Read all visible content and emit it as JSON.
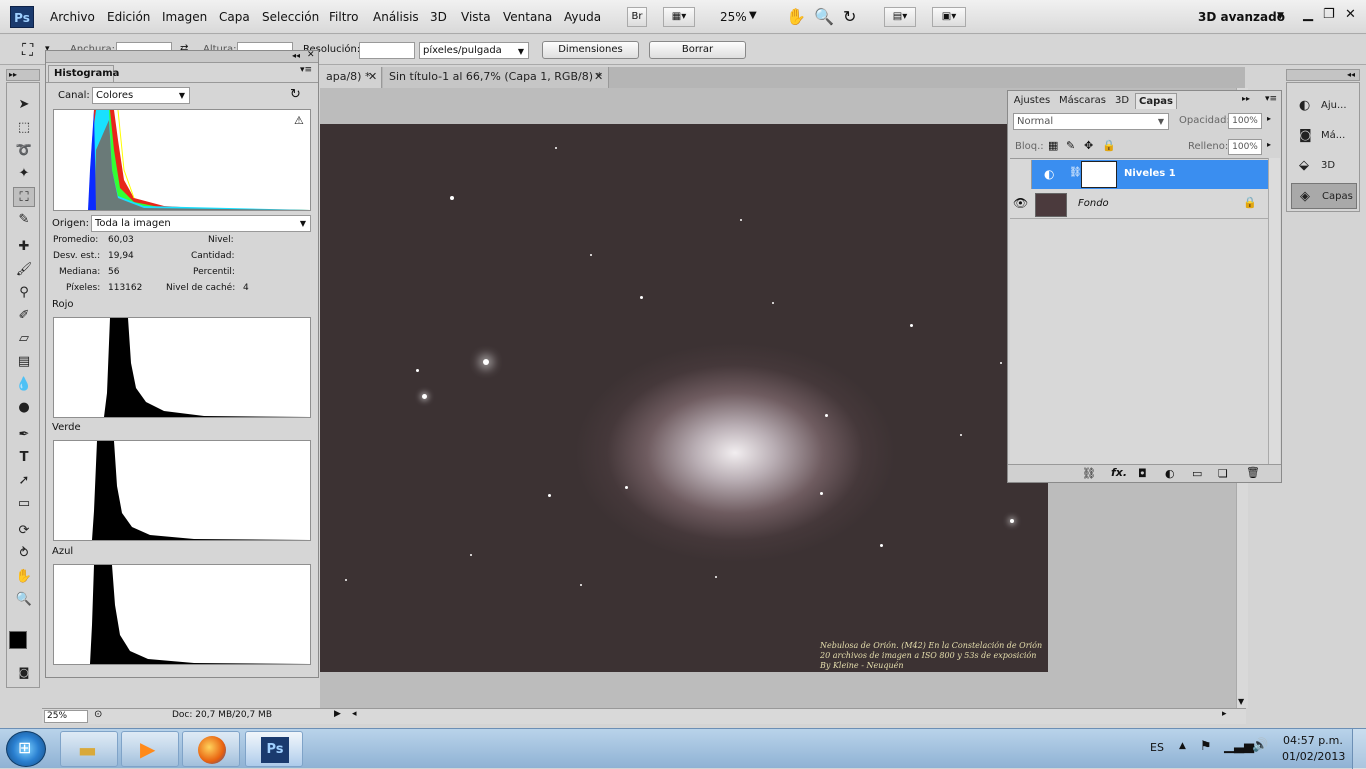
{
  "app": {
    "logo": "Ps",
    "menu": [
      "Archivo",
      "Edición",
      "Imagen",
      "Capa",
      "Selección",
      "Filtro",
      "Análisis",
      "3D",
      "Vista",
      "Ventana",
      "Ayuda"
    ],
    "bridge": "Br",
    "zoom": "25%",
    "workspace": "3D avanzado"
  },
  "options": {
    "width_label": "Anchura:",
    "height_label": "Altura:",
    "resolution_label": "Resolución:",
    "units": "píxeles/pulgada",
    "dimensions_btn": "Dimensiones",
    "clear_btn": "Borrar"
  },
  "tabs": [
    {
      "label": "apa/8) *"
    },
    {
      "label": "Sin título-1 al 66,7% (Capa 1, RGB/8) *"
    }
  ],
  "histogram": {
    "title": "Histograma",
    "channel_label": "Canal:",
    "channel_value": "Colores",
    "source_label": "Origen:",
    "source_value": "Toda la imagen",
    "stats": {
      "mean_label": "Promedio:",
      "mean": "60,03",
      "stdev_label": "Desv. est.:",
      "stdev": "19,94",
      "median_label": "Mediana:",
      "median": "56",
      "pixels_label": "Píxeles:",
      "pixels": "113162",
      "level_label": "Nivel:",
      "count_label": "Cantidad:",
      "percentile_label": "Percentil:",
      "cache_label": "Nivel de caché:",
      "cache": "4"
    },
    "red_label": "Rojo",
    "green_label": "Verde",
    "blue_label": "Azul"
  },
  "layers": {
    "tabs": [
      "Ajustes",
      "Máscaras",
      "3D",
      "Capas"
    ],
    "blend_mode": "Normal",
    "opacity_label": "Opacidad:",
    "opacity": "100%",
    "lock_label": "Bloq.:",
    "fill_label": "Relleno:",
    "fill": "100%",
    "items": [
      {
        "name": "Niveles 1",
        "selected": true
      },
      {
        "name": "Fondo",
        "selected": false
      }
    ],
    "footer_fx": "fx."
  },
  "dock": [
    "Aju...",
    "Má...",
    "3D",
    "Capas"
  ],
  "status": {
    "zoom": "25%",
    "doc": "Doc: 20,7 MB/20,7 MB"
  },
  "image_caption": [
    "Nebulosa de Orión. (M42) En la Constelación de Orión",
    "20 archivos de imagen a ISO 800 y 53s de exposición",
    "By Kleine - Neuquén"
  ],
  "taskbar": {
    "lang": "ES",
    "time": "04:57 p.m.",
    "date": "01/02/2013",
    "ps_label": "Ps"
  },
  "colors": {
    "selection_blue": "#3a8ef0",
    "ps_blue": "#1a3a6e",
    "nebula_bg": "#3c3233"
  }
}
